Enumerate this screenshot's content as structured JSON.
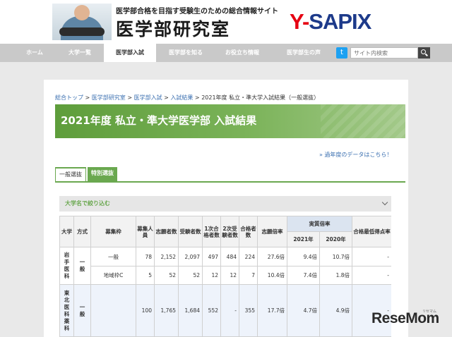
{
  "header": {
    "tagline": "医学部合格を目指す受験生のための総合情報サイト",
    "site_title": "医学部研究室",
    "brand_initial": "Y-",
    "brand_rest": "SAPIX"
  },
  "nav": {
    "items": [
      {
        "label": "ホーム"
      },
      {
        "label": "大学一覧"
      },
      {
        "label": "医学部入試"
      },
      {
        "label": "医学部を知る"
      },
      {
        "label": "お役立ち情報"
      },
      {
        "label": "医学部生の声"
      }
    ],
    "active_index": 2,
    "twitter_glyph": "t",
    "search_placeholder": "サイト内検索"
  },
  "breadcrumb": {
    "items": [
      "総合トップ",
      "医学部研究室",
      "医学部入試",
      "入試結果"
    ],
    "separator": " > ",
    "current": "2021年度 私立・準大学入試結果（一般選抜）"
  },
  "page_title": "2021年度 私立・準大学医学部 入試結果",
  "prev_link": "» 過年度のデータはこちら！",
  "tabs": [
    {
      "label": "一般選抜",
      "active": true
    },
    {
      "label": "特別選抜",
      "active": false
    }
  ],
  "filter_label": "大学名で絞り込む",
  "table": {
    "headers": {
      "university": "大学",
      "method": "方式",
      "category": "募集枠",
      "capacity": "募集人員",
      "applicants": "志願者数",
      "examinees": "受験者数",
      "pass1": "1次合格者数",
      "exam2": "2次受験者数",
      "passers": "合格者数",
      "app_rate": "志願倍率",
      "actual_rate": "実質倍率",
      "year_2021": "2021年",
      "year_2020": "2020年",
      "min_score": "合格最低得点率"
    },
    "groups": [
      {
        "university": "岩手医科",
        "method": "一般",
        "rows": [
          {
            "category": "一般",
            "capacity": "78",
            "applicants": "2,152",
            "examinees": "2,097",
            "pass1": "497",
            "exam2": "484",
            "passers": "224",
            "app_rate": "27.6倍",
            "r2021": "9.4倍",
            "r2020": "10.7倍",
            "min": "-"
          },
          {
            "category": "地域枠C",
            "capacity": "5",
            "applicants": "52",
            "examinees": "52",
            "pass1": "12",
            "exam2": "12",
            "passers": "7",
            "app_rate": "10.4倍",
            "r2021": "7.4倍",
            "r2020": "1.8倍",
            "min": "-"
          }
        ]
      },
      {
        "university": "東北医科薬科",
        "method": "一般",
        "rows": [
          {
            "category": "",
            "capacity": "100",
            "applicants": "1,765",
            "examinees": "1,684",
            "pass1": "552",
            "exam2": "-",
            "passers": "355",
            "app_rate": "17.7倍",
            "r2021": "4.7倍",
            "r2020": "4.9倍",
            "min": "-"
          }
        ]
      }
    ]
  },
  "watermark": {
    "text": "ReseMom",
    "sub": "リセマム"
  }
}
